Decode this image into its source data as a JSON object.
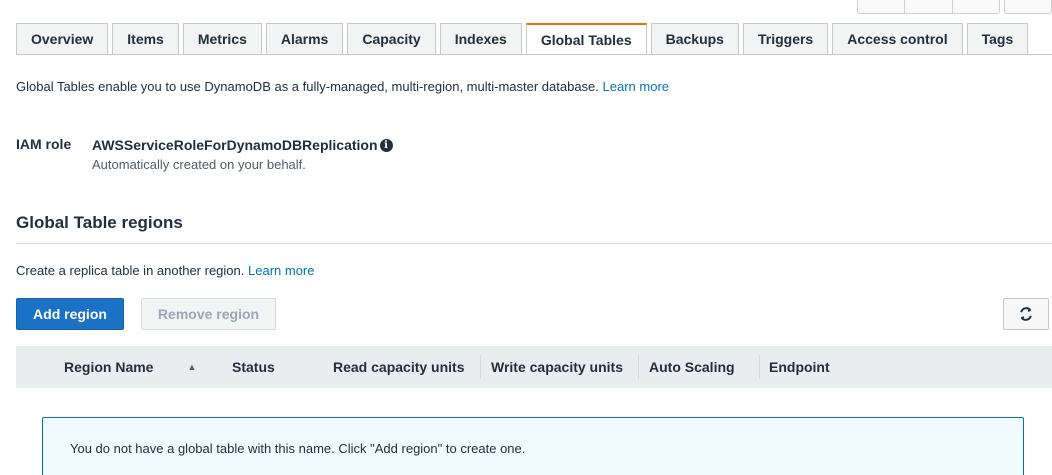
{
  "tabs": [
    {
      "label": "Overview"
    },
    {
      "label": "Items"
    },
    {
      "label": "Metrics"
    },
    {
      "label": "Alarms"
    },
    {
      "label": "Capacity"
    },
    {
      "label": "Indexes"
    },
    {
      "label": "Global Tables",
      "active": true
    },
    {
      "label": "Backups"
    },
    {
      "label": "Triggers"
    },
    {
      "label": "Access control"
    },
    {
      "label": "Tags"
    }
  ],
  "intro": {
    "text": "Global Tables enable you to use DynamoDB as a fully-managed, multi-region, multi-master database.",
    "link": "Learn more"
  },
  "iam": {
    "label": "IAM role",
    "value": "AWSServiceRoleForDynamoDBReplication",
    "note": "Automatically created on your behalf."
  },
  "regions": {
    "title": "Global Table regions",
    "description": "Create a replica table in another region.",
    "link": "Learn more",
    "add_button": "Add region",
    "remove_button": "Remove region"
  },
  "table": {
    "columns": [
      "Region Name",
      "Status",
      "Read capacity units",
      "Write capacity units",
      "Auto Scaling",
      "Endpoint"
    ],
    "empty_message": "You do not have a global table with this name. Click \"Add region\" to create one."
  },
  "colors": {
    "accent": "#ec7211",
    "primary_button": "#1b72c4",
    "link": "#0073bb",
    "info_box_border": "#0073bb",
    "info_box_bg": "#f1faff"
  },
  "icons": {
    "info": "info-circle-icon",
    "refresh": "refresh-icon",
    "sort": "sort-ascending-icon"
  }
}
